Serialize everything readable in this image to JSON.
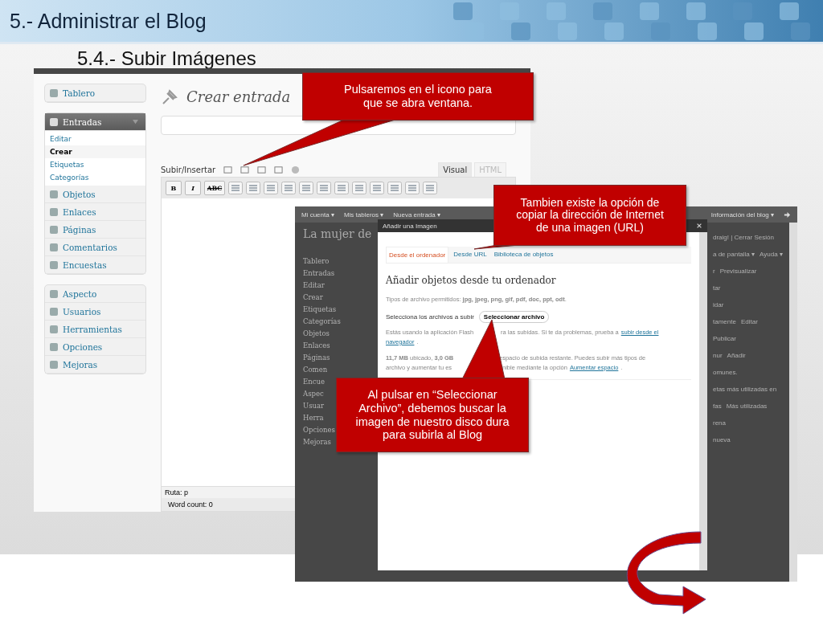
{
  "header": {
    "title": "5.- Administrar el Blog"
  },
  "subtitle": "5.4.- Subir Imágenes",
  "editor": {
    "menu_groups": [
      {
        "items": [
          {
            "label": "Tablero",
            "expanded": false
          }
        ]
      },
      {
        "items": [
          {
            "label": "Entradas",
            "expanded": true,
            "children": [
              {
                "label": "Editar",
                "selected": false
              },
              {
                "label": "Crear",
                "selected": true
              },
              {
                "label": "Etiquetas",
                "selected": false
              },
              {
                "label": "Categorías",
                "selected": false
              }
            ]
          },
          {
            "label": "Objetos",
            "expanded": false
          },
          {
            "label": "Enlaces",
            "expanded": false
          },
          {
            "label": "Páginas",
            "expanded": false
          },
          {
            "label": "Comentarios",
            "expanded": false
          },
          {
            "label": "Encuestas",
            "expanded": false
          }
        ]
      },
      {
        "items": [
          {
            "label": "Aspecto",
            "expanded": false
          },
          {
            "label": "Usuarios",
            "expanded": false
          },
          {
            "label": "Herramientas",
            "expanded": false
          },
          {
            "label": "Opciones",
            "expanded": false
          },
          {
            "label": "Mejoras",
            "expanded": false
          }
        ]
      }
    ],
    "page_title": "Crear entrada",
    "upload_label": "Subir/Insertar",
    "view_tabs": [
      {
        "label": "Visual",
        "selected": true
      },
      {
        "label": "HTML",
        "selected": false
      }
    ],
    "format_buttons": [
      "B",
      "I",
      "ABC"
    ],
    "path": "Ruta: p",
    "word_count": "Word count: 0"
  },
  "background_admin": {
    "admin_bar": [
      "Mi cuenta ▾",
      "Mis tableros ▾",
      "Nueva entrada ▾"
    ],
    "blog_info": "Información del blog ▾",
    "site_title": "La mujer de",
    "sidebar": [
      "Tablero",
      "Entradas",
      "Editar",
      "Crear",
      "Etiquetas",
      "Categorías",
      "Objetos",
      "Enlaces",
      "Páginas",
      "Comen",
      "Encue",
      "Aspec",
      "Usuar",
      "Herra",
      "Opciones",
      "Mejoras"
    ],
    "right_rows": [
      [
        "draig! | Cerrar Sesión"
      ],
      [
        "a de pantalla ▾",
        "Ayuda ▾"
      ],
      [
        "r",
        "Previsualizar"
      ],
      [
        "tar"
      ],
      [
        "idar"
      ],
      [
        "tamente",
        "Editar"
      ],
      [
        "Publicar"
      ],
      [
        "nur",
        "Añadir"
      ],
      [
        "omunes."
      ],
      [
        "etas más utilizadas en"
      ],
      [
        "fas",
        "Más utilizadas"
      ],
      [
        "rena"
      ],
      [
        "nueva"
      ]
    ]
  },
  "dialog": {
    "title": "Añadir una Imagen",
    "tabs": [
      {
        "label": "Desde el ordenador",
        "selected": true
      },
      {
        "label": "Desde URL",
        "selected": false
      },
      {
        "label": "Biblioteca de objetos",
        "selected": false
      }
    ],
    "heading": "Añadir objetos desde tu ordenador",
    "allowed_types": "Tipos de archivo permitidos: **jpg, jpeg, png, gif, pdf, doc, ppt, odt**.",
    "select_label": "Selecciona los archivos a subir",
    "select_button": "Seleccionar archivo",
    "flash_note": [
      [
        {
          "kind": "text",
          "text": "Estás usando la aplicación Flash"
        },
        {
          "kind": "text",
          "text": "ra las subidas. Si te da problemas, prueba a"
        },
        {
          "kind": "link",
          "text": "subir desde el"
        }
      ],
      [
        {
          "kind": "link",
          "text": "navegador"
        },
        {
          "kind": "text",
          "text": "."
        }
      ]
    ],
    "usage_note": [
      [
        {
          "kind": "text",
          "text": "**11,7 MB** ubicado, **3,0 GB**"
        },
        {
          "kind": "text",
          "text": "espacio de subida restante. Puedes subir más tipos de"
        }
      ],
      [
        {
          "kind": "text",
          "text": "archivo y aumentar tu es"
        },
        {
          "kind": "text",
          "text": "nible mediante la opción"
        },
        {
          "kind": "link",
          "text": "Aumentar espacio"
        },
        {
          "kind": "text",
          "text": "."
        }
      ]
    ]
  },
  "callouts": [
    {
      "text": "Pulsaremos en el icono para que se abra ventana."
    },
    {
      "text": "Tambien existe la opción de copiar la dirección de Internet de una imagen (URL)"
    },
    {
      "text": "Al pulsar en “Seleccionar Archivo”, debemos buscar la imagen de nuestro disco dura para subirla al Blog"
    }
  ]
}
